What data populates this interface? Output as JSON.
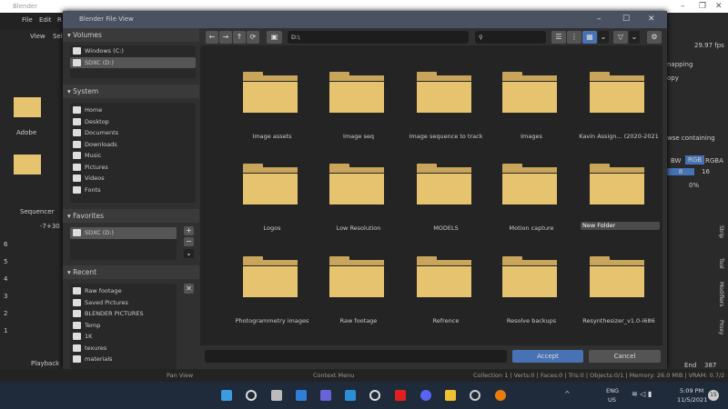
{
  "app": {
    "title": "Blender",
    "menu": [
      "File",
      "Edit",
      "R"
    ],
    "view": "View",
    "sel": "Sel"
  },
  "right": {
    "fps": "29.97 fps",
    "snapping": "napping",
    "copy": "opy",
    "browse": "wse containing",
    "color_modes": [
      "BW",
      "RGB",
      "RGBA"
    ],
    "depth": [
      "8",
      "16"
    ],
    "pct": "0%",
    "tabs": [
      "Strip",
      "Tool",
      "Modifiers",
      "Proxy"
    ],
    "end_label": "End",
    "end_value": "387"
  },
  "left": {
    "sequencer": "Sequencer",
    "offset": "-7+30",
    "channels": [
      "6",
      "5",
      "4",
      "3",
      "2",
      "1"
    ],
    "playback": "Playback",
    "folder_label": "Adobe"
  },
  "dialog": {
    "title": "Blender File View",
    "path": "D:\\",
    "search_placeholder": "",
    "volumes": {
      "header": "Volumes",
      "items": [
        "Windows (C:)",
        "SDXC (D:)"
      ]
    },
    "system": {
      "header": "System",
      "items": [
        "Home",
        "Desktop",
        "Documents",
        "Downloads",
        "Music",
        "Pictures",
        "Videos",
        "Fonts"
      ]
    },
    "favorites": {
      "header": "Favorites",
      "items": [
        "SDXC (D:)"
      ]
    },
    "recent": {
      "header": "Recent",
      "items": [
        "Raw footage",
        "Saved Pictures",
        "BLENDER PICTURES",
        "Temp",
        "1K",
        "texures",
        "materials"
      ]
    },
    "folders": [
      "Image assets",
      "Image seq",
      "Image sequence to track",
      "Images",
      "Kavin Assign... (2020-2021",
      "Logos",
      "Low Resolution",
      "MODELS",
      "Motion capture",
      "New Folder",
      "Photogrammetry images",
      "Raw footage",
      "Refrence",
      "Resolve backups",
      "Resynthesizer_v1.0-i686"
    ],
    "new_folder_value": "New Folder",
    "filename": "",
    "accept": "Accept",
    "cancel": "Cancel"
  },
  "status": {
    "left": "Pan View",
    "mid": "Context Menu",
    "right": "Collection 1 | Verts:0 | Faces:0 | Tris:0 | Objects:0/1 | Memory: 26.0 MiB | VRAM: 0.7/2"
  },
  "taskbar": {
    "lang": "ENG",
    "region": "US",
    "time": "5:09 PM",
    "date": "11/5/2021",
    "badge": "15"
  },
  "colors": {
    "accent": "#4772b3",
    "folder": "#e6c36f",
    "title": "#4a5261"
  }
}
